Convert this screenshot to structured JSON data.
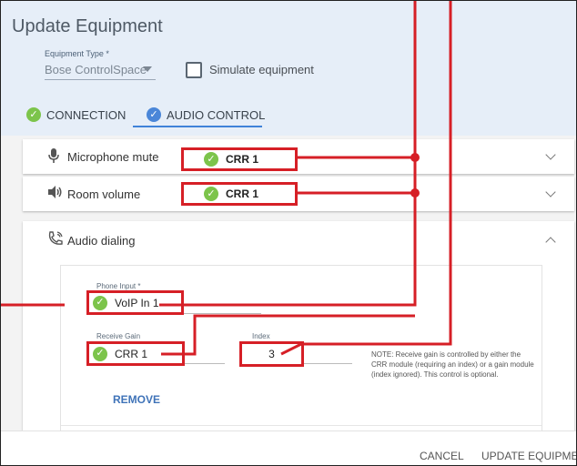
{
  "dialog": {
    "title": "Update Equipment"
  },
  "equipment": {
    "type_label": "Equipment Type *",
    "type_value": "Bose ControlSpace",
    "simulate_label": "Simulate equipment"
  },
  "tabs": [
    {
      "label": "CONNECTION",
      "status": "complete",
      "icon": "check-circle-icon"
    },
    {
      "label": "AUDIO CONTROL",
      "status": "active",
      "icon": "check-circle-icon"
    }
  ],
  "controls": {
    "mic_mute": {
      "label": "Microphone mute",
      "module": "CRR 1",
      "icon": "microphone-icon"
    },
    "room_volume": {
      "label": "Room volume",
      "module": "CRR 1",
      "icon": "speaker-icon"
    },
    "audio_dialing": {
      "label": "Audio dialing",
      "icon": "phone-icon",
      "phone_input_label": "Phone Input *",
      "phone_input_value": "VoIP In 1",
      "receive_gain_label": "Receive Gain",
      "receive_gain_value": "CRR 1",
      "index_label": "Index",
      "index_value": "3",
      "note": "NOTE: Receive gain is controlled by either the CRR module (requiring an index) or a gain module (index ignored). This control is optional.",
      "remove_label": "REMOVE"
    }
  },
  "footer": {
    "cancel_label": "CANCEL",
    "update_label": "UPDATE EQUIPMENT"
  },
  "colors": {
    "accent": "#3f82d9",
    "success": "#7cc44b",
    "highlight": "#d61f26",
    "header_bg": "#e6eef8"
  }
}
